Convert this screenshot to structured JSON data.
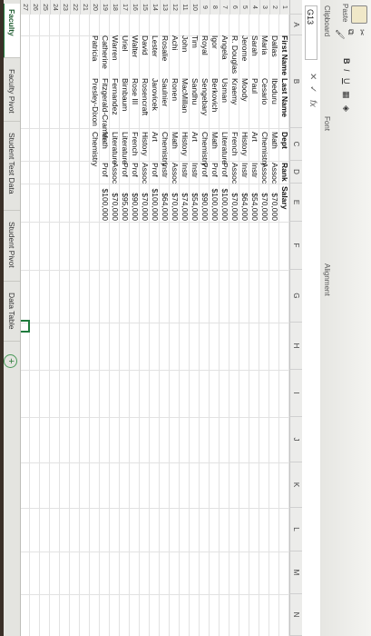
{
  "ribbon": {
    "paste_label": "Paste",
    "clipboard_label": "Clipboard",
    "font_label": "Font",
    "alignment_label": "Alignment",
    "bold": "B",
    "italic": "I",
    "underline": "U"
  },
  "formula_bar": {
    "name_box": "G13",
    "fx": "fx",
    "cancel": "✕",
    "confirm": "✓"
  },
  "columns": [
    "A",
    "B",
    "C",
    "D",
    "E",
    "F",
    "G",
    "H",
    "I",
    "J",
    "K",
    "L",
    "M",
    "N"
  ],
  "row_numbers": [
    "1",
    "2",
    "3",
    "4",
    "5",
    "6",
    "7",
    "8",
    "9",
    "10",
    "11",
    "12",
    "13",
    "14",
    "15",
    "16",
    "17",
    "18",
    "19",
    "20",
    "21",
    "22",
    "23",
    "24",
    "25",
    "26",
    "27"
  ],
  "headers": {
    "first": "First Name",
    "last": "Last Name",
    "dept": "Dept",
    "rank": "Rank",
    "salary": "Salary"
  },
  "rows": [
    {
      "first": "Dallas",
      "last": "Ibeduru",
      "dept": "Math",
      "rank": "Assoc",
      "salary": "$70,000"
    },
    {
      "first": "Maria",
      "last": "Cesario",
      "dept": "Chemistry",
      "rank": "Assoc",
      "salary": "$70,000"
    },
    {
      "first": "Sarah",
      "last": "Paul",
      "dept": "Art",
      "rank": "Instr",
      "salary": "$54,000"
    },
    {
      "first": "Jerome",
      "last": "Moody",
      "dept": "History",
      "rank": "Instr",
      "salary": "$64,000"
    },
    {
      "first": "R. Douglas",
      "last": "Kraemy",
      "dept": "French",
      "rank": "Assoc",
      "salary": "$70,000"
    },
    {
      "first": "Angela",
      "last": "Usman",
      "dept": "Literature",
      "rank": "Prof",
      "salary": "$100,000"
    },
    {
      "first": "Igor",
      "last": "Berkovich",
      "dept": "Math",
      "rank": "Prof",
      "salary": "$100,000"
    },
    {
      "first": "Royal",
      "last": "Sengebary",
      "dept": "Chemistry",
      "rank": "Prof",
      "salary": "$90,000"
    },
    {
      "first": "Tim",
      "last": "Sandhu",
      "dept": "Art",
      "rank": "Instr",
      "salary": "$54,000"
    },
    {
      "first": "John",
      "last": "MacMillan",
      "dept": "History",
      "rank": "Instr",
      "salary": "$74,000"
    },
    {
      "first": "Achi",
      "last": "Ronen",
      "dept": "Math",
      "rank": "Assoc",
      "salary": "$70,000"
    },
    {
      "first": "Rosalie",
      "last": "Saulnier",
      "dept": "Chemistry",
      "rank": "Instr",
      "salary": "$64,000"
    },
    {
      "first": "Lester",
      "last": "Jarovicek",
      "dept": "Art",
      "rank": "Prof",
      "salary": "$100,000"
    },
    {
      "first": "David",
      "last": "Rosencraft",
      "dept": "History",
      "rank": "Assoc",
      "salary": "$70,000"
    },
    {
      "first": "Walter",
      "last": "Rose III",
      "dept": "French",
      "rank": "Prof",
      "salary": "$90,000"
    },
    {
      "first": "Uriel",
      "last": "Birnbaum",
      "dept": "Literature",
      "rank": "Prof",
      "salary": "$95,000"
    },
    {
      "first": "Warren",
      "last": "Fernandez",
      "dept": "Literature",
      "rank": "Assoc",
      "salary": "$70,000"
    },
    {
      "first": "Catherine",
      "last": "Fitzgerald-Cramer",
      "dept": "Math",
      "rank": "Prof",
      "salary": "$100,000"
    },
    {
      "first": "Patricia",
      "last": "Presley-Dixon",
      "dept": "Chemistry",
      "rank": "",
      "salary": ""
    }
  ],
  "sheet_tabs": [
    "Faculty Data",
    "Faculty Pivot",
    "Student Test Data",
    "Student Pivot",
    "Data Table"
  ],
  "add_tab": "+",
  "colors": {
    "accent": "#1f7a3c"
  }
}
